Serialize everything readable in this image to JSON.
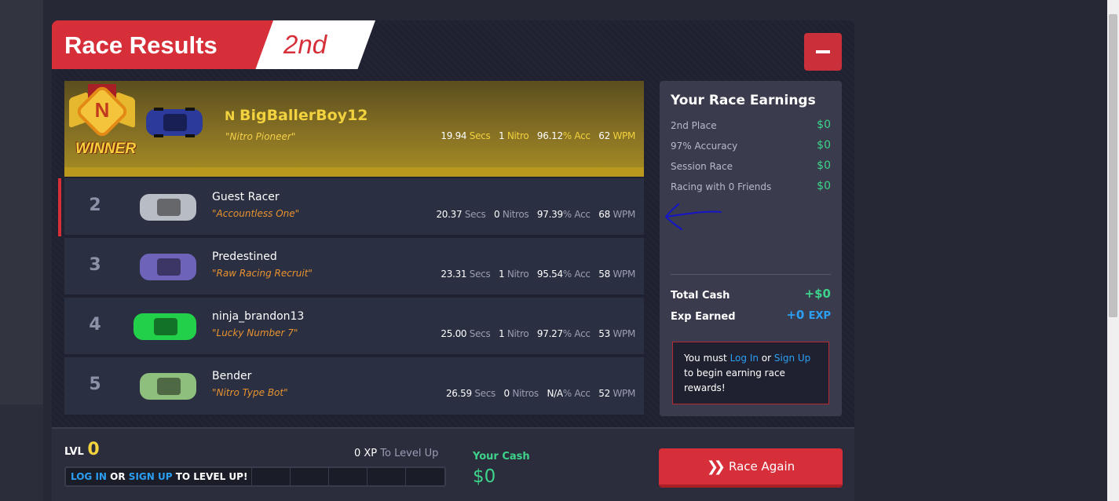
{
  "window": {
    "title": "Race Results",
    "place": "2nd"
  },
  "winner": {
    "badge_label": "WINNER",
    "name": "BigBallerBoy12",
    "title": "\"Nitro Pioneer\"",
    "secs": "19.94",
    "secs_unit": "Secs",
    "nitros": "1",
    "nitros_unit": "Nitro",
    "acc": "96.12",
    "acc_unit": "% Acc",
    "wpm": "62",
    "wpm_unit": "WPM",
    "car_color": "#2c3a9c"
  },
  "racers": [
    {
      "rank": "2",
      "name": "Guest Racer",
      "title": "\"Accountless One\"",
      "secs": "20.37",
      "secs_unit": "Secs",
      "nitros": "0",
      "nitros_unit": "Nitros",
      "acc": "97.39",
      "acc_unit": "% Acc",
      "wpm": "68",
      "wpm_unit": "WPM",
      "car_color": "#b8bcc4"
    },
    {
      "rank": "3",
      "name": "Predestined",
      "title": "\"Raw Racing Recruit\"",
      "secs": "23.31",
      "secs_unit": "Secs",
      "nitros": "1",
      "nitros_unit": "Nitro",
      "acc": "95.54",
      "acc_unit": "% Acc",
      "wpm": "58",
      "wpm_unit": "WPM",
      "car_color": "#6d63b8"
    },
    {
      "rank": "4",
      "name": "ninja_brandon13",
      "title": "\"Lucky Number 7\"",
      "secs": "25.00",
      "secs_unit": "Secs",
      "nitros": "1",
      "nitros_unit": "Nitro",
      "acc": "97.27",
      "acc_unit": "% Acc",
      "wpm": "53",
      "wpm_unit": "WPM",
      "car_color": "#22d04a"
    },
    {
      "rank": "5",
      "name": "Bender",
      "title": "\"Nitro Type Bot\"",
      "secs": "26.59",
      "secs_unit": "Secs",
      "nitros": "0",
      "nitros_unit": "Nitros",
      "acc": "N/A",
      "acc_unit": "% Acc",
      "wpm": "52",
      "wpm_unit": "WPM",
      "car_color": "#8fbf7c"
    }
  ],
  "earnings": {
    "title": "Your Race Earnings",
    "lines": [
      {
        "label": "2nd Place",
        "value": "$0"
      },
      {
        "label": "97% Accuracy",
        "value": "$0"
      },
      {
        "label": "Session Race",
        "value": "$0"
      },
      {
        "label": "Racing with 0 Friends",
        "value": "$0"
      }
    ],
    "total_cash_label": "Total Cash",
    "total_cash_value": "+$0",
    "exp_label": "Exp Earned",
    "exp_value": "+0",
    "exp_unit": "EXP",
    "notice": {
      "pre": "You must ",
      "login": "Log In",
      "mid": " or ",
      "signup": "Sign Up",
      "post": " to begin earning race rewards!"
    }
  },
  "footer": {
    "lvl_label": "LVL",
    "lvl_value": "0",
    "xp_value": "0 XP",
    "xp_unit": "To Level Up",
    "login": "LOG IN",
    "or": "OR",
    "signup": "SIGN UP",
    "msg": "TO LEVEL UP!",
    "cash_label": "Your Cash",
    "cash_value": "$0",
    "race_again": "Race Again"
  },
  "colors": {
    "accent_red": "#d62f3a",
    "gold": "#f2d23e",
    "cash_green": "#3ed38b",
    "link_blue": "#2c9ff2"
  },
  "icons": {
    "minimize": "minus-icon",
    "race_again": "double-chevron-right-icon",
    "badge": "nitro-winner-badge-icon"
  }
}
